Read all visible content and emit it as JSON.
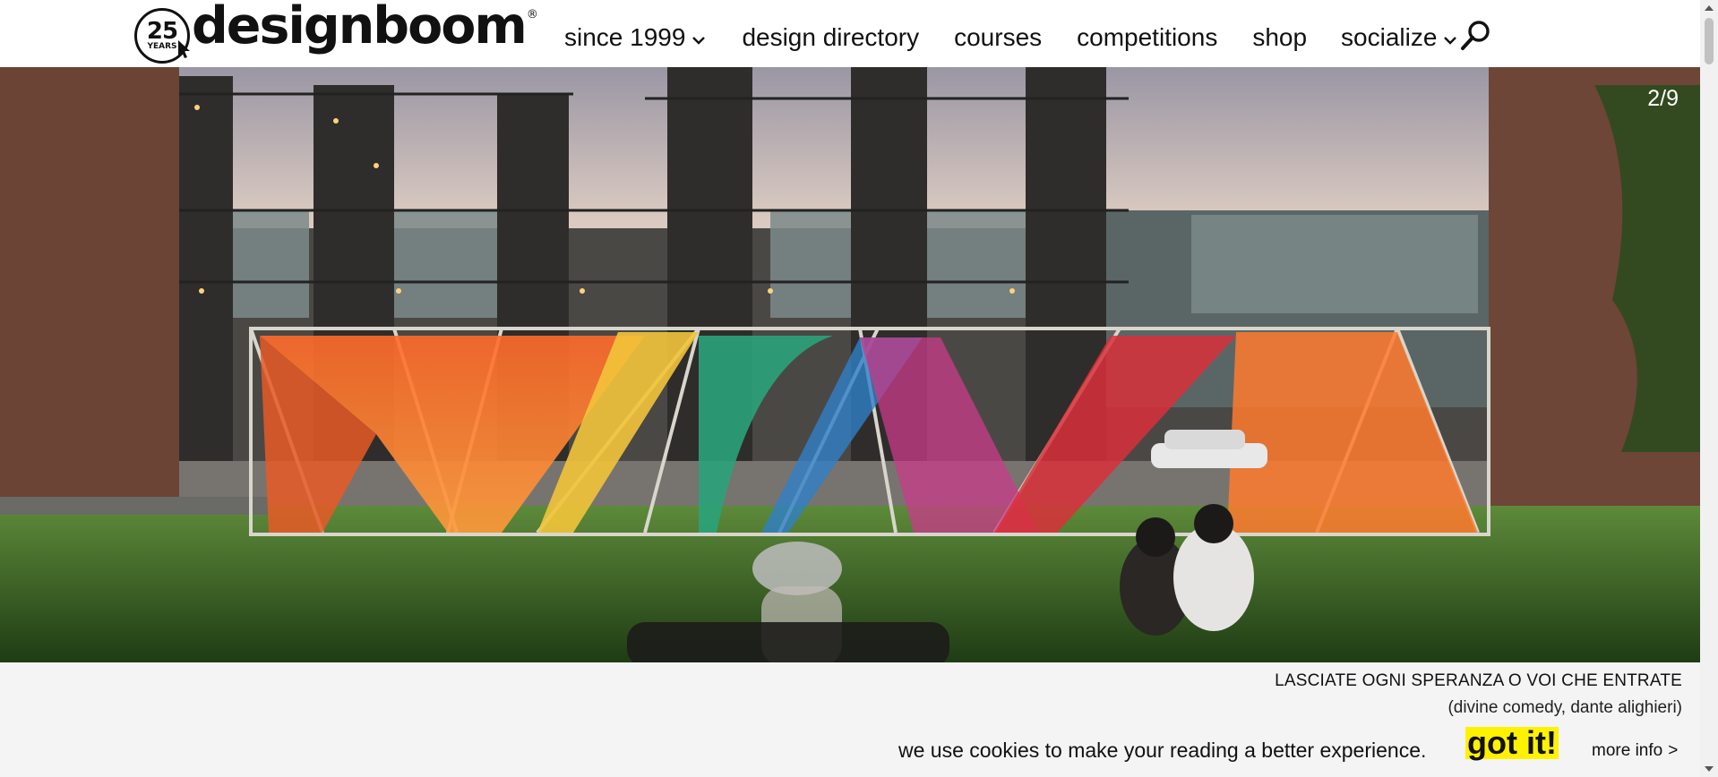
{
  "logo": {
    "badge_number": "25",
    "badge_text": "YEARS",
    "wordmark": "designboom",
    "registered": "®"
  },
  "nav": {
    "items": [
      {
        "label": "since 1999",
        "has_dropdown": true
      },
      {
        "label": "design directory",
        "has_dropdown": false
      },
      {
        "label": "courses",
        "has_dropdown": false
      },
      {
        "label": "competitions",
        "has_dropdown": false
      },
      {
        "label": "shop",
        "has_dropdown": false
      },
      {
        "label": "socialize",
        "has_dropdown": true
      }
    ],
    "search_icon": "search-icon"
  },
  "hero": {
    "counter": "2/9",
    "image_icon": "photo-installation"
  },
  "caption": {
    "quote": "LASCIATE OGNI SPERANZA O VOI CHE ENTRATE",
    "source": "(divine comedy, dante alighieri)"
  },
  "cookie": {
    "message": "we use cookies to make your reading a better experience.",
    "accept_label": "got it!",
    "more_info_label": "more info",
    "more_info_arrow": ">"
  },
  "colors": {
    "accent_yellow": "#fff200",
    "band_background": "#f4f4f4",
    "text": "#111111"
  }
}
